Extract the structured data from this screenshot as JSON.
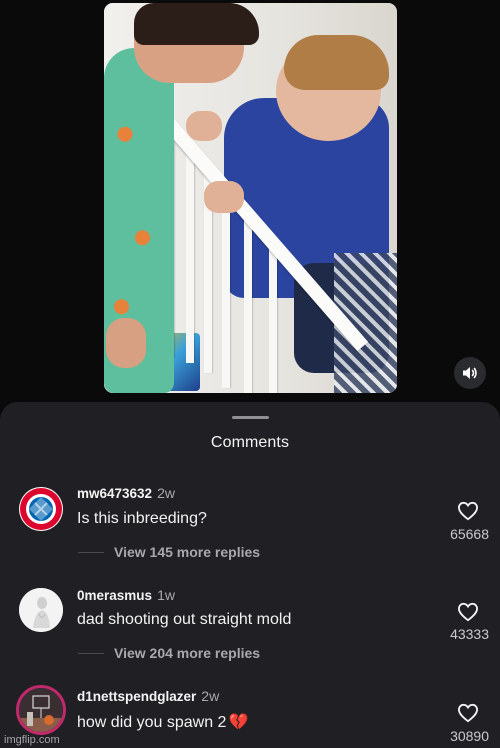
{
  "video": {
    "sound_icon": "speaker-volume-icon"
  },
  "sheet": {
    "title": "Comments"
  },
  "comments": [
    {
      "username": "mw6473632",
      "time": "2w",
      "text": "Is this inbreeding?",
      "replies_label": "View 145 more replies",
      "likes": "65668",
      "avatar_icon": "bayern-munchen-crest-icon"
    },
    {
      "username": "0merasmus",
      "time": "1w",
      "text": "dad shooting out straight mold",
      "replies_label": "View 204 more replies",
      "likes": "43333",
      "avatar_icon": "statue-avatar-icon"
    },
    {
      "username": "d1nettspendglazer",
      "time": "2w",
      "text": "how did you spawn 2",
      "text_emoji": "💔",
      "likes": "30890",
      "avatar_icon": "basketball-avatar-icon"
    }
  ],
  "watermark": "imgflip.com",
  "colors": {
    "background": "#0a0a0b",
    "sheet": "#202024",
    "muted_text": "#a8a8ad",
    "heart_emoji": "#e0245e"
  }
}
